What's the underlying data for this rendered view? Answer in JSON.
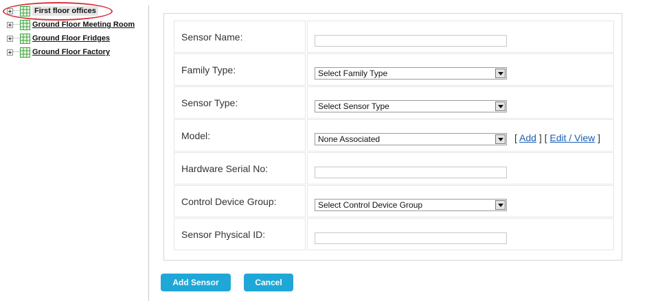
{
  "tree": {
    "items": [
      {
        "label": "First floor offices",
        "selected": true
      },
      {
        "label": "Ground Floor Meeting Room",
        "selected": false
      },
      {
        "label": "Ground Floor Fridges",
        "selected": false
      },
      {
        "label": "Ground Floor Factory",
        "selected": false
      }
    ],
    "icon": "grid-icon",
    "icon_color": "#3aa13a",
    "highlight_color": "#d8323b"
  },
  "form": {
    "sensor_name": {
      "label": "Sensor Name:",
      "value": ""
    },
    "family_type": {
      "label": "Family Type:",
      "selected": "Select Family Type"
    },
    "sensor_type": {
      "label": "Sensor Type:",
      "selected": "Select Sensor Type"
    },
    "model": {
      "label": "Model:",
      "selected": "None Associated",
      "add_link": "Add",
      "edit_link": "Edit / View"
    },
    "hardware_serial": {
      "label": "Hardware Serial No:",
      "value": ""
    },
    "control_device_group": {
      "label": "Control Device Group:",
      "selected": "Select Control Device Group"
    },
    "sensor_physical_id": {
      "label": "Sensor Physical ID:",
      "value": ""
    }
  },
  "buttons": {
    "add_sensor": "Add Sensor",
    "cancel": "Cancel",
    "color": "#1fa7d8"
  }
}
